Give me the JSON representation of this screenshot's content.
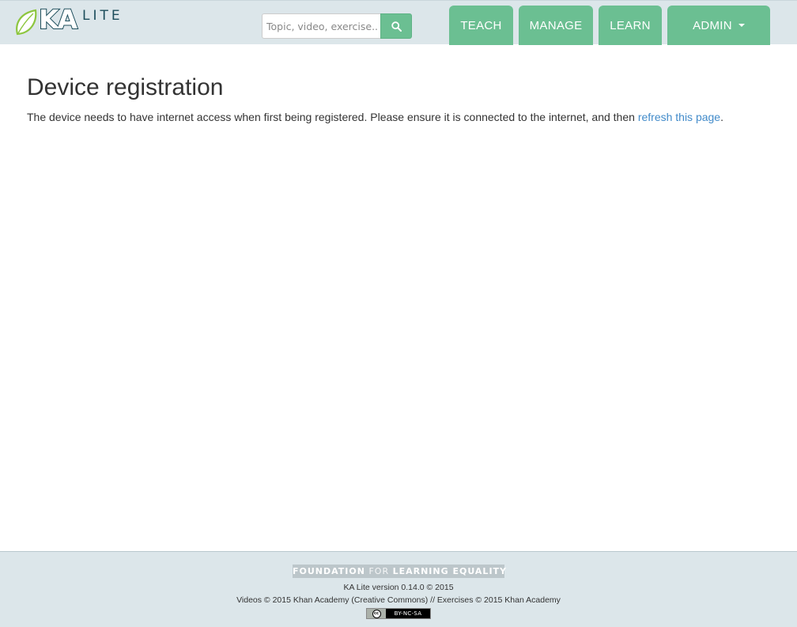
{
  "header": {
    "logo": {
      "primary": "KA",
      "secondary": "LITE"
    },
    "search": {
      "placeholder": "Topic, video, exercise...",
      "button_icon": "search-icon"
    },
    "nav": {
      "teach": "TEACH",
      "manage": "MANAGE",
      "learn": "LEARN",
      "admin": "ADMIN"
    }
  },
  "main": {
    "title": "Device registration",
    "message_before": "The device needs to have internet access when first being registered. Please ensure it is connected to the internet, and then ",
    "message_link": "refresh this page",
    "message_after": "."
  },
  "footer": {
    "banner_foundation": "FOUNDATION",
    "banner_for": "FOR",
    "banner_learning_equality": "LEARNING EQUALITY",
    "version": "KA Lite version 0.14.0 © 2015",
    "videos_prefix": "Videos © 2015 Khan Academy (",
    "creative_commons": "Creative Commons",
    "videos_suffix": ") // Exercises © 2015 Khan Academy",
    "license_cc": "cc",
    "license_label": "BY-NC-SA"
  },
  "colors": {
    "header_bg": "#dce6ea",
    "nav_green": "#6bbf92",
    "link_blue": "#428bca",
    "logo_dark": "#1c4d5b",
    "leaf_green": "#8dc63f"
  }
}
